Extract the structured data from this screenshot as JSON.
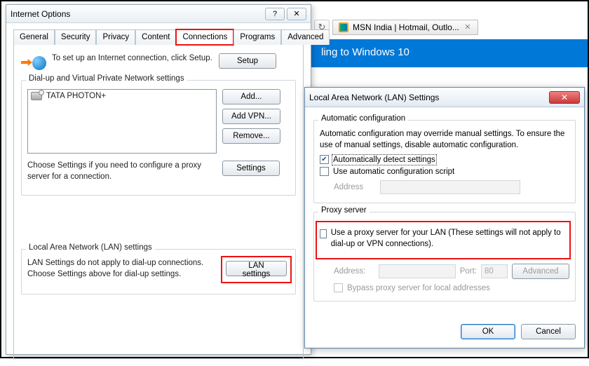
{
  "browser": {
    "tab_title": "MSN India | Hotmail, Outlo...",
    "banner_text": "ling to Windows 10"
  },
  "io": {
    "title": "Internet Options",
    "tabs": [
      "General",
      "Security",
      "Privacy",
      "Content",
      "Connections",
      "Programs",
      "Advanced"
    ],
    "active_tab_index": 4,
    "setup_text": "To set up an Internet connection, click Setup.",
    "setup_btn": "Setup",
    "dialup_group": "Dial-up and Virtual Private Network settings",
    "conn_item": "TATA PHOTON+",
    "add_btn": "Add...",
    "add_vpn_btn": "Add VPN...",
    "remove_btn": "Remove...",
    "settings_btn": "Settings",
    "settings_text": "Choose Settings if you need to configure a proxy server for a connection.",
    "lan_group": "Local Area Network (LAN) settings",
    "lan_text": "LAN Settings do not apply to dial-up connections. Choose Settings above for dial-up settings.",
    "lan_btn": "LAN settings"
  },
  "lan": {
    "title": "Local Area Network (LAN) Settings",
    "auto_group": "Automatic configuration",
    "auto_desc": "Automatic configuration may override manual settings.  To ensure the use of manual settings, disable automatic configuration.",
    "auto_detect": "Automatically detect settings",
    "auto_detect_checked": true,
    "use_script": "Use automatic configuration script",
    "use_script_checked": false,
    "address_lbl": "Address",
    "proxy_group": "Proxy server",
    "use_proxy": "Use a proxy server for your LAN (These settings will not apply to dial-up or VPN connections).",
    "use_proxy_checked": false,
    "proxy_addr_lbl": "Address:",
    "port_lbl": "Port:",
    "port_value": "80",
    "advanced_btn": "Advanced",
    "bypass": "Bypass proxy server for local addresses",
    "bypass_checked": false,
    "ok_btn": "OK",
    "cancel_btn": "Cancel"
  }
}
